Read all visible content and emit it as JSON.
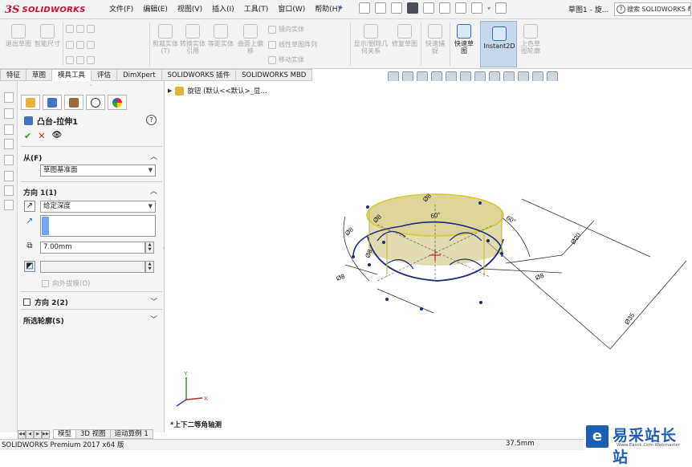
{
  "app": {
    "brand": "SOLIDWORKS",
    "brand_color": "#c8102e",
    "accent": "#2f6fc0"
  },
  "menu": [
    "文件(F)",
    "编辑(E)",
    "视图(V)",
    "插入(I)",
    "工具(T)",
    "窗口(W)",
    "帮助(H)"
  ],
  "title": {
    "document": "草图1 - 旋...",
    "search_placeholder": "搜索 SOLIDWORKS 帮助"
  },
  "ribbon": {
    "exit_sketch": "退出草图",
    "smart_dimension": "智能尺寸",
    "trim": "剪裁实体(T)",
    "convert": "转换实体引用",
    "offset": "等距实体",
    "offset_surface": "曲面上偏移",
    "mirror": "镜向实体",
    "linear_pattern": "线性草图阵列",
    "move": "移动实体",
    "show_relations": "显示/删除几何关系",
    "repair": "修复草图",
    "quick_snaps": "快速捕捉",
    "rapid_sketch": "快速草图",
    "instant2d": "Instant2D",
    "shaded_sketch": "上色草图轮廓"
  },
  "tabs": [
    "特征",
    "草图",
    "模具工具",
    "评估",
    "DimXpert",
    "SOLIDWORKS 插件",
    "SOLIDWORKS MBD"
  ],
  "active_tab": "草图",
  "property_manager": {
    "feature_title": "凸台-拉伸1",
    "from_label": "从(F)",
    "from_value": "草图基准面",
    "direction1_label": "方向 1(1)",
    "end_condition": "给定深度",
    "depth": "7.00mm",
    "draft_outward": "向外拔模(O)",
    "direction2_label": "方向 2(2)",
    "selected_contours": "所选轮廓(S)"
  },
  "tree": {
    "root": "旋钮 (默认<<默认>_显..."
  },
  "viewport": {
    "view_label": "*上下二等角轴测",
    "dims": {
      "d8a": "Ø8",
      "d8b": "Ø8",
      "d8c": "Ø8",
      "d8d": "Ø8",
      "d8e": "Ø8",
      "d8f": "Ø8",
      "d20": "Ø20",
      "d35": "Ø35",
      "r60": "60°",
      "r60b": "60°"
    },
    "model_color": "#c8bd6e",
    "edge_color": "#1c2a80"
  },
  "bottom_tabs": [
    "模型",
    "3D 视图",
    "运动算例 1"
  ],
  "status": {
    "left": "SOLIDWORKS Premium 2017 x64 版",
    "value": "37.5mm"
  },
  "watermark": {
    "name": "易采站长站",
    "url": "Www.Easck.Com Webmaster"
  }
}
